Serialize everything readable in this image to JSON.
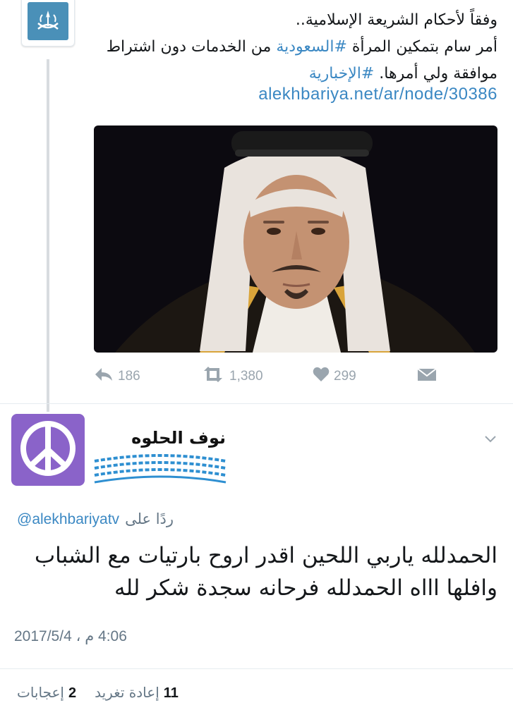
{
  "top_tweet": {
    "text_line1": "وفقاً لأحكام الشريعة الإسلامية..",
    "text_line2_before": "أمر سام بتمكين المرأة ",
    "text_line2_hashtag": "#السعودية",
    "text_line2_after": " من الخدمات دون اشتراط",
    "text_line3_before": "موافقة ولي أمرها. ",
    "text_line3_hashtag": "#الإخبارية",
    "link": "alekhbariya.net/ar/node/30386",
    "actions": {
      "reply_count": "186",
      "retweet_count": "1,380",
      "like_count": "299"
    }
  },
  "reply_tweet": {
    "author_name": "نوف الحلوه",
    "replying_label": "ردًا على",
    "replying_handle": "@alekhbariyatv",
    "text": "الحمدلله ياربي اللحين اقدر اروح بارتيات مع الشباب وافلها اااه الحمدلله فرحانه سجدة شكر لله",
    "timestamp": "4:06 م ، 2017/5/4",
    "likes_count": "2",
    "likes_label": "إعجابات",
    "retweets_count": "11",
    "retweets_label": "إعادة تغريد"
  },
  "colors": {
    "link": "#3b88c3",
    "muted": "#657786",
    "avatar_purple": "#8a63c9"
  }
}
